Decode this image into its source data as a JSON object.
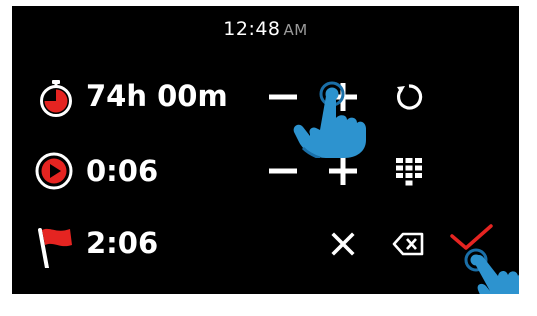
{
  "clock": {
    "time": "12:48",
    "ampm": "AM"
  },
  "rows": [
    {
      "name": "timer",
      "icon": "stopwatch-icon",
      "value": "74h 00m",
      "icon_color": "#e52421"
    },
    {
      "name": "elapsed",
      "icon": "play-circle-icon",
      "value": "0:06",
      "icon_color": "#e52421"
    },
    {
      "name": "finish",
      "icon": "flag-icon",
      "value": "2:06",
      "icon_color": "#e52421"
    }
  ],
  "controls": {
    "row1": [
      "minus-icon",
      "plus-icon",
      "reset-icon"
    ],
    "row2": [
      "minus-icon",
      "plus-icon",
      "keypad-icon"
    ],
    "row3": [
      "close-icon",
      "backspace-icon",
      "confirm-check-icon"
    ]
  },
  "colors": {
    "screen_bg": "#000000",
    "text": "#ffffff",
    "accent_red": "#e52421",
    "touch_hand": "#2d93cf",
    "touch_ring": "#1a6fa8"
  }
}
